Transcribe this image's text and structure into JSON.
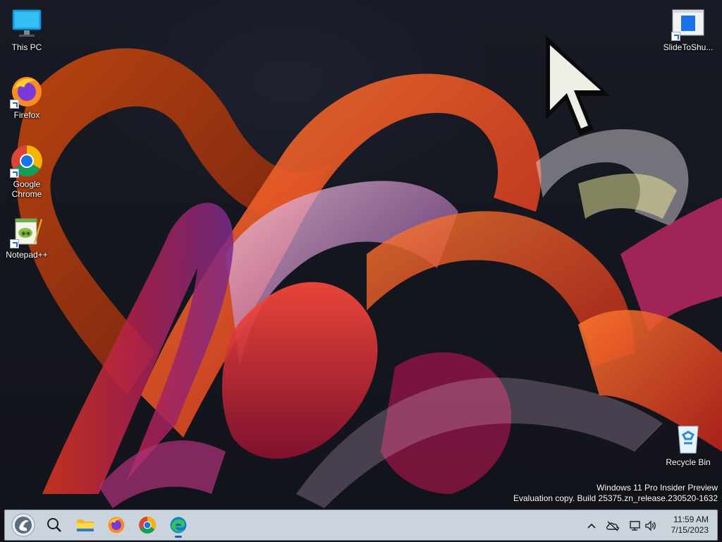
{
  "desktop": {
    "icons": [
      {
        "label": "This PC",
        "icon": "computer-icon"
      },
      {
        "label": "Firefox",
        "icon": "firefox-icon"
      },
      {
        "label": "Google Chrome",
        "icon": "chrome-icon"
      },
      {
        "label": "Notepad++",
        "icon": "notepad-plus-plus-icon"
      },
      {
        "label": "SlideToShu...",
        "icon": "slidetoshutdown-icon"
      },
      {
        "label": "Recycle Bin",
        "icon": "recycle-bin-icon"
      }
    ]
  },
  "watermark": {
    "line1": "Windows 11 Pro Insider Preview",
    "line2": "Evaluation copy. Build 25375.zn_release.230520-1632"
  },
  "taskbar": {
    "pinned": [
      {
        "name": "start-button",
        "icon": "start-logo-icon"
      },
      {
        "name": "search-button",
        "icon": "search-icon"
      },
      {
        "name": "file-explorer-button",
        "icon": "folder-icon"
      },
      {
        "name": "firefox-button",
        "icon": "firefox-icon"
      },
      {
        "name": "chrome-button",
        "icon": "chrome-icon"
      },
      {
        "name": "edge-button",
        "icon": "edge-icon",
        "active": true
      }
    ],
    "tray": [
      "chevron-up-icon",
      "onedrive-offline-icon",
      "network-icon",
      "volume-icon"
    ],
    "clock": {
      "time": "11:59 AM",
      "date": "7/15/2023"
    }
  },
  "colors": {
    "taskbar_bg": "#cbd3dd",
    "accent": "#1a5fb4"
  }
}
